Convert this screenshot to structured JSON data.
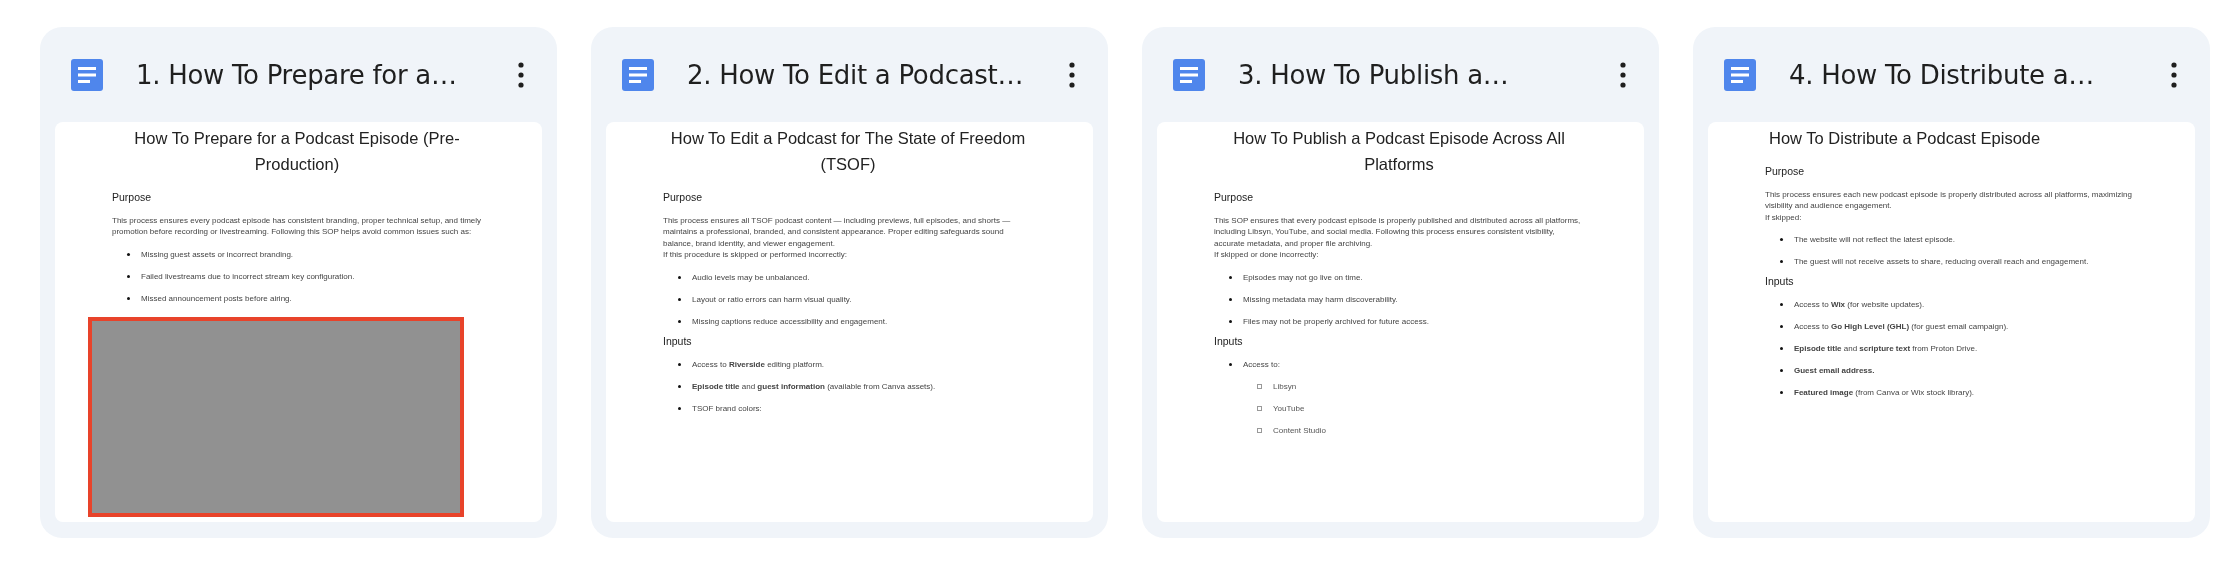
{
  "documents": [
    {
      "title": "1. How To Prepare for a…",
      "redacted": true,
      "preview": [
        {
          "kind": "title",
          "text": "How To Prepare for a Podcast Episode (Pre-Production)"
        },
        {
          "kind": "heading",
          "text": "Purpose"
        },
        {
          "kind": "para",
          "text": "This process ensures every podcast episode has consistent branding, proper technical setup, and timely promotion before recording or livestreaming. Following this SOP helps avoid common issues such as:"
        },
        {
          "kind": "bullet",
          "text": "Missing guest assets or incorrect branding."
        },
        {
          "kind": "bullet",
          "text": "Failed livestreams due to incorrect stream key configuration."
        },
        {
          "kind": "bullet",
          "text": "Missed announcement posts before airing."
        }
      ]
    },
    {
      "title": "2. How To Edit a Podcast…",
      "redacted": false,
      "preview": [
        {
          "kind": "title",
          "text": "How To Edit a Podcast for The State of Freedom (TSOF)"
        },
        {
          "kind": "heading",
          "text": "Purpose"
        },
        {
          "kind": "para",
          "text": "This process ensures all TSOF podcast content — including previews, full episodes, and shorts — maintains a professional, branded, and consistent appearance. Proper editing safeguards sound balance, brand identity, and viewer engagement."
        },
        {
          "kind": "para",
          "text": " If this procedure is skipped or performed incorrectly:"
        },
        {
          "kind": "bullet",
          "text": "Audio levels may be unbalanced."
        },
        {
          "kind": "bullet",
          "text": "Layout or ratio errors can harm visual quality."
        },
        {
          "kind": "bullet",
          "text": "Missing captions reduce accessibility and engagement."
        },
        {
          "kind": "heading",
          "text": "Inputs"
        },
        {
          "kind": "bullet",
          "text": "Access to **Riverside** editing platform."
        },
        {
          "kind": "bullet",
          "text": "**Episode title** and **guest information** (available from Canva assets)."
        },
        {
          "kind": "bullet",
          "text": "TSOF brand colors:"
        }
      ]
    },
    {
      "title": "3. How To Publish a…",
      "redacted": false,
      "preview": [
        {
          "kind": "title",
          "text": "How To Publish a Podcast Episode Across All Platforms"
        },
        {
          "kind": "heading",
          "text": "Purpose"
        },
        {
          "kind": "para",
          "text": "This SOP ensures that every podcast episode is properly published and distributed across all platforms, including Libsyn, YouTube, and social media. Following this process ensures consistent visibility, accurate metadata, and proper file archiving."
        },
        {
          "kind": "para",
          "text": "If skipped or done incorrectly:"
        },
        {
          "kind": "bullet",
          "text": "Episodes may not go live on time."
        },
        {
          "kind": "bullet",
          "text": "Missing metadata may harm discoverability."
        },
        {
          "kind": "bullet",
          "text": "Files may not be properly archived for future access."
        },
        {
          "kind": "heading",
          "text": "Inputs"
        },
        {
          "kind": "bullet",
          "text": "Access to:"
        },
        {
          "kind": "subbullet",
          "text": "Libsyn"
        },
        {
          "kind": "subbullet",
          "text": "YouTube"
        },
        {
          "kind": "subbullet",
          "text": "Content Studio"
        }
      ]
    },
    {
      "title": "4. How To Distribute a…",
      "redacted": false,
      "preview": [
        {
          "kind": "title_left",
          "text": "How To Distribute a Podcast Episode"
        },
        {
          "kind": "heading",
          "text": "Purpose"
        },
        {
          "kind": "para",
          "text": "This process ensures each new podcast episode is properly distributed across all platforms, maximizing visibility and audience engagement."
        },
        {
          "kind": "para",
          "text": " If skipped:"
        },
        {
          "kind": "bullet",
          "text": "The website will not reflect the latest episode."
        },
        {
          "kind": "bullet",
          "text": "The guest will not receive assets to share, reducing overall reach and engagement."
        },
        {
          "kind": "heading",
          "text": "Inputs"
        },
        {
          "kind": "bullet",
          "text": "Access to **Wix** (for website updates)."
        },
        {
          "kind": "bullet",
          "text": "Access to **Go High Level (GHL)** (for guest email campaign)."
        },
        {
          "kind": "bullet",
          "text": "**Episode title** and **scripture text** from Proton Drive."
        },
        {
          "kind": "bullet",
          "text": "**Guest email address.**"
        },
        {
          "kind": "bullet",
          "text": "**Featured image** (from Canva or Wix stock library)."
        }
      ]
    }
  ]
}
